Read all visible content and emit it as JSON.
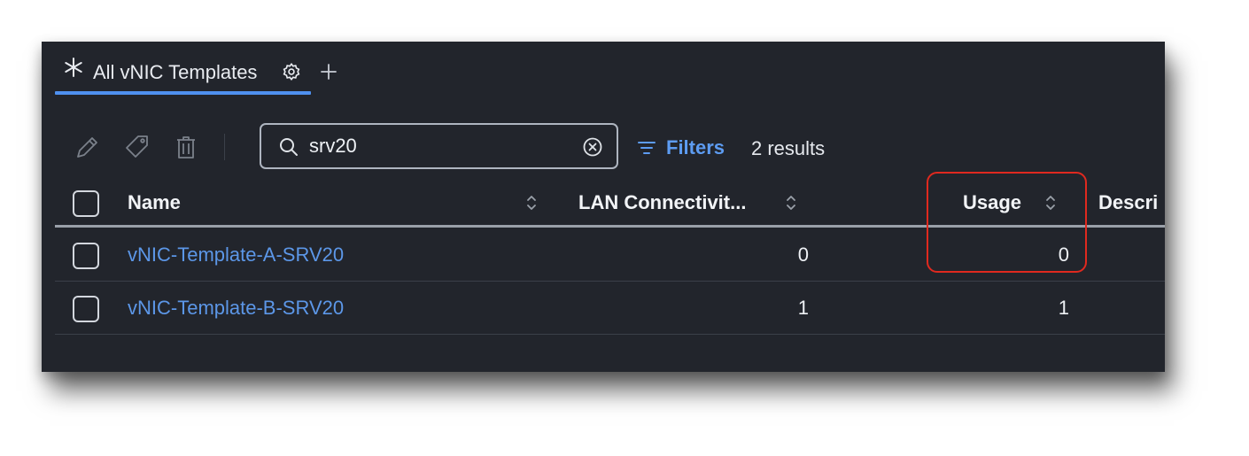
{
  "tabs": {
    "active_tab": {
      "label": "All vNIC Templates",
      "icon": "asterisk-icon",
      "settings_icon": "gear-icon"
    },
    "add_tab_icon": "plus-icon"
  },
  "toolbar": {
    "actions": [
      "edit-icon",
      "tag-icon",
      "trash-icon"
    ],
    "search": {
      "value": "srv20",
      "icon": "search-icon",
      "clear_icon": "clear-circle-icon"
    },
    "filters_label": "Filters",
    "results_label": "2 results"
  },
  "table": {
    "columns": [
      "Name",
      "LAN Connectivit...",
      "Usage",
      "Descri"
    ],
    "rows": [
      {
        "name": "vNIC-Template-A-SRV20",
        "lan_connectivity": "0",
        "usage": "0"
      },
      {
        "name": "vNIC-Template-B-SRV20",
        "lan_connectivity": "1",
        "usage": "1"
      }
    ]
  },
  "colors": {
    "background": "#22252c",
    "accent": "#4f91f0",
    "link": "#5c97e8",
    "highlight": "#e0291f"
  }
}
